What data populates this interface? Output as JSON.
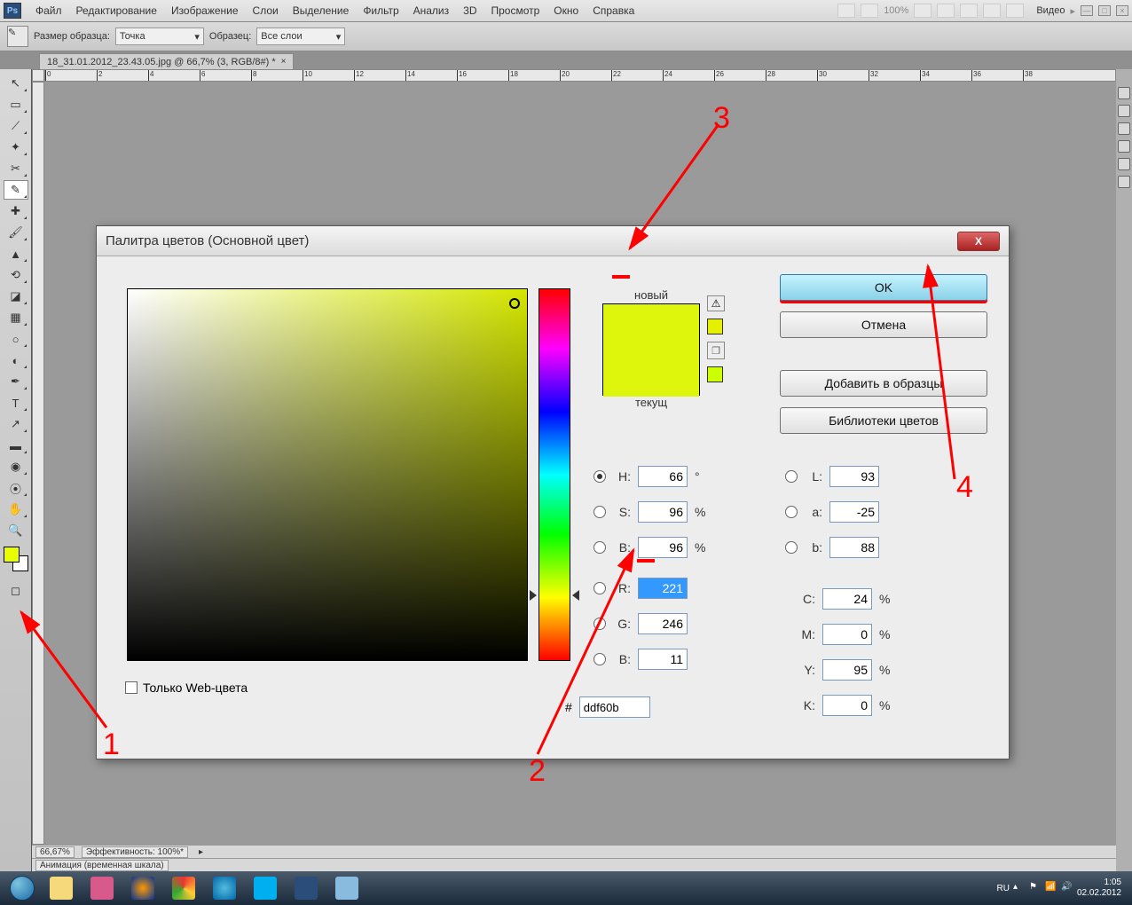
{
  "menubar": {
    "items": [
      "Файл",
      "Редактирование",
      "Изображение",
      "Слои",
      "Выделение",
      "Фильтр",
      "Анализ",
      "3D",
      "Просмотр",
      "Окно",
      "Справка"
    ],
    "zoom": "100%",
    "workspace_label": "Видео"
  },
  "optionsbar": {
    "sample_size_label": "Размер образца:",
    "sample_size_value": "Точка",
    "sample_label": "Образец:",
    "sample_value": "Все слои"
  },
  "document": {
    "tab_title": "18_31.01.2012_23.43.05.jpg @ 66,7% (3, RGB/8#) *",
    "zoom_status": "66,67%",
    "efficiency": "Эффективность: 100%*",
    "timeline": "Анимация (временная шкала)"
  },
  "ruler_ticks": [
    "0",
    "2",
    "4",
    "6",
    "8",
    "10",
    "12",
    "14",
    "16",
    "18",
    "20",
    "22",
    "24",
    "26",
    "28",
    "30",
    "32",
    "34",
    "36",
    "38"
  ],
  "dialog": {
    "title": "Палитра цветов (Основной цвет)",
    "new_label": "новый",
    "current_label": "текущ",
    "ok": "OK",
    "cancel": "Отмена",
    "add_swatch": "Добавить в образцы",
    "libraries": "Библиотеки цветов",
    "webonly": "Только Web-цвета",
    "H": "66",
    "S": "96",
    "Bv": "96",
    "R": "221",
    "G": "246",
    "Bb": "11",
    "L": "93",
    "a": "-25",
    "b": "88",
    "C": "24",
    "M": "0",
    "Y": "95",
    "K": "0",
    "hex": "ddf60b",
    "deg": "°",
    "pct": "%",
    "labels": {
      "H": "H:",
      "S": "S:",
      "B": "B:",
      "R": "R:",
      "G": "G:",
      "Bb": "B:",
      "L": "L:",
      "a": "a:",
      "b": "b:",
      "C": "C:",
      "M": "M:",
      "Y": "Y:",
      "K": "K:",
      "hash": "#"
    }
  },
  "annotations": {
    "n1": "1",
    "n2": "2",
    "n3": "3",
    "n4": "4"
  },
  "tray": {
    "lang": "RU",
    "time": "1:05",
    "date": "02.02.2012"
  }
}
